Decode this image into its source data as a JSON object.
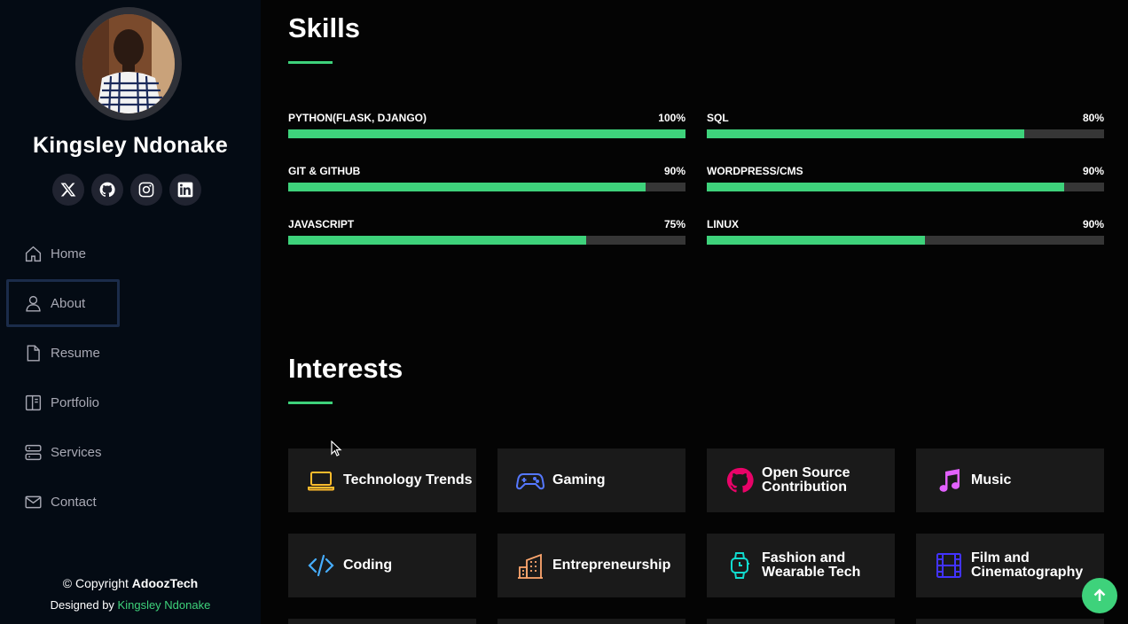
{
  "profile": {
    "name": "Kingsley Ndonake"
  },
  "socials": [
    {
      "icon": "x-twitter-icon"
    },
    {
      "icon": "github-icon"
    },
    {
      "icon": "instagram-icon"
    },
    {
      "icon": "linkedin-icon"
    }
  ],
  "nav": {
    "items": [
      {
        "label": "Home",
        "icon": "home-icon"
      },
      {
        "label": "About",
        "icon": "person-icon",
        "active": true
      },
      {
        "label": "Resume",
        "icon": "file-icon"
      },
      {
        "label": "Portfolio",
        "icon": "book-icon"
      },
      {
        "label": "Services",
        "icon": "server-icon"
      },
      {
        "label": "Contact",
        "icon": "envelope-icon"
      }
    ]
  },
  "footer": {
    "copyright_prefix": "© Copyright ",
    "copyright_brand": "AdoozTech",
    "designed_prefix": "Designed by ",
    "designer": "Kingsley Ndonake"
  },
  "skills": {
    "title": "Skills",
    "items": [
      {
        "name": "PYTHON(FLASK, DJANGO)",
        "percent_label": "100%",
        "level": 100
      },
      {
        "name": "SQL",
        "percent_label": "80%",
        "level": 80
      },
      {
        "name": "GIT & GITHUB",
        "percent_label": "90%",
        "level": 90
      },
      {
        "name": "WORDPRESS/CMS",
        "percent_label": "90%",
        "level": 90
      },
      {
        "name": "JAVASCRIPT",
        "percent_label": "75%",
        "level": 75
      },
      {
        "name": "LINUX",
        "percent_label": "90%",
        "level": 55
      }
    ]
  },
  "interests": {
    "title": "Interests",
    "items": [
      {
        "label": "Technology Trends",
        "icon": "laptop-icon",
        "color": "#ffbb2c"
      },
      {
        "label": "Gaming",
        "icon": "gamepad-icon",
        "color": "#5578ff"
      },
      {
        "label": "Open Source Contribution",
        "icon": "github-icon",
        "color": "#e80368"
      },
      {
        "label": "Music",
        "icon": "music-note-icon",
        "color": "#e361ff"
      },
      {
        "label": "Coding",
        "icon": "code-slash-icon",
        "color": "#47aeff"
      },
      {
        "label": "Entrepreneurship",
        "icon": "buildings-icon",
        "color": "#ffa76e"
      },
      {
        "label": "Fashion and Wearable Tech",
        "icon": "smartwatch-icon",
        "color": "#11dbcf"
      },
      {
        "label": "Film and Cinematography",
        "icon": "film-icon",
        "color": "#4233ff"
      }
    ]
  },
  "colors": {
    "accent": "#3ed27b",
    "sidebar_bg": "#040b14",
    "card_bg": "#1a1a1a"
  }
}
